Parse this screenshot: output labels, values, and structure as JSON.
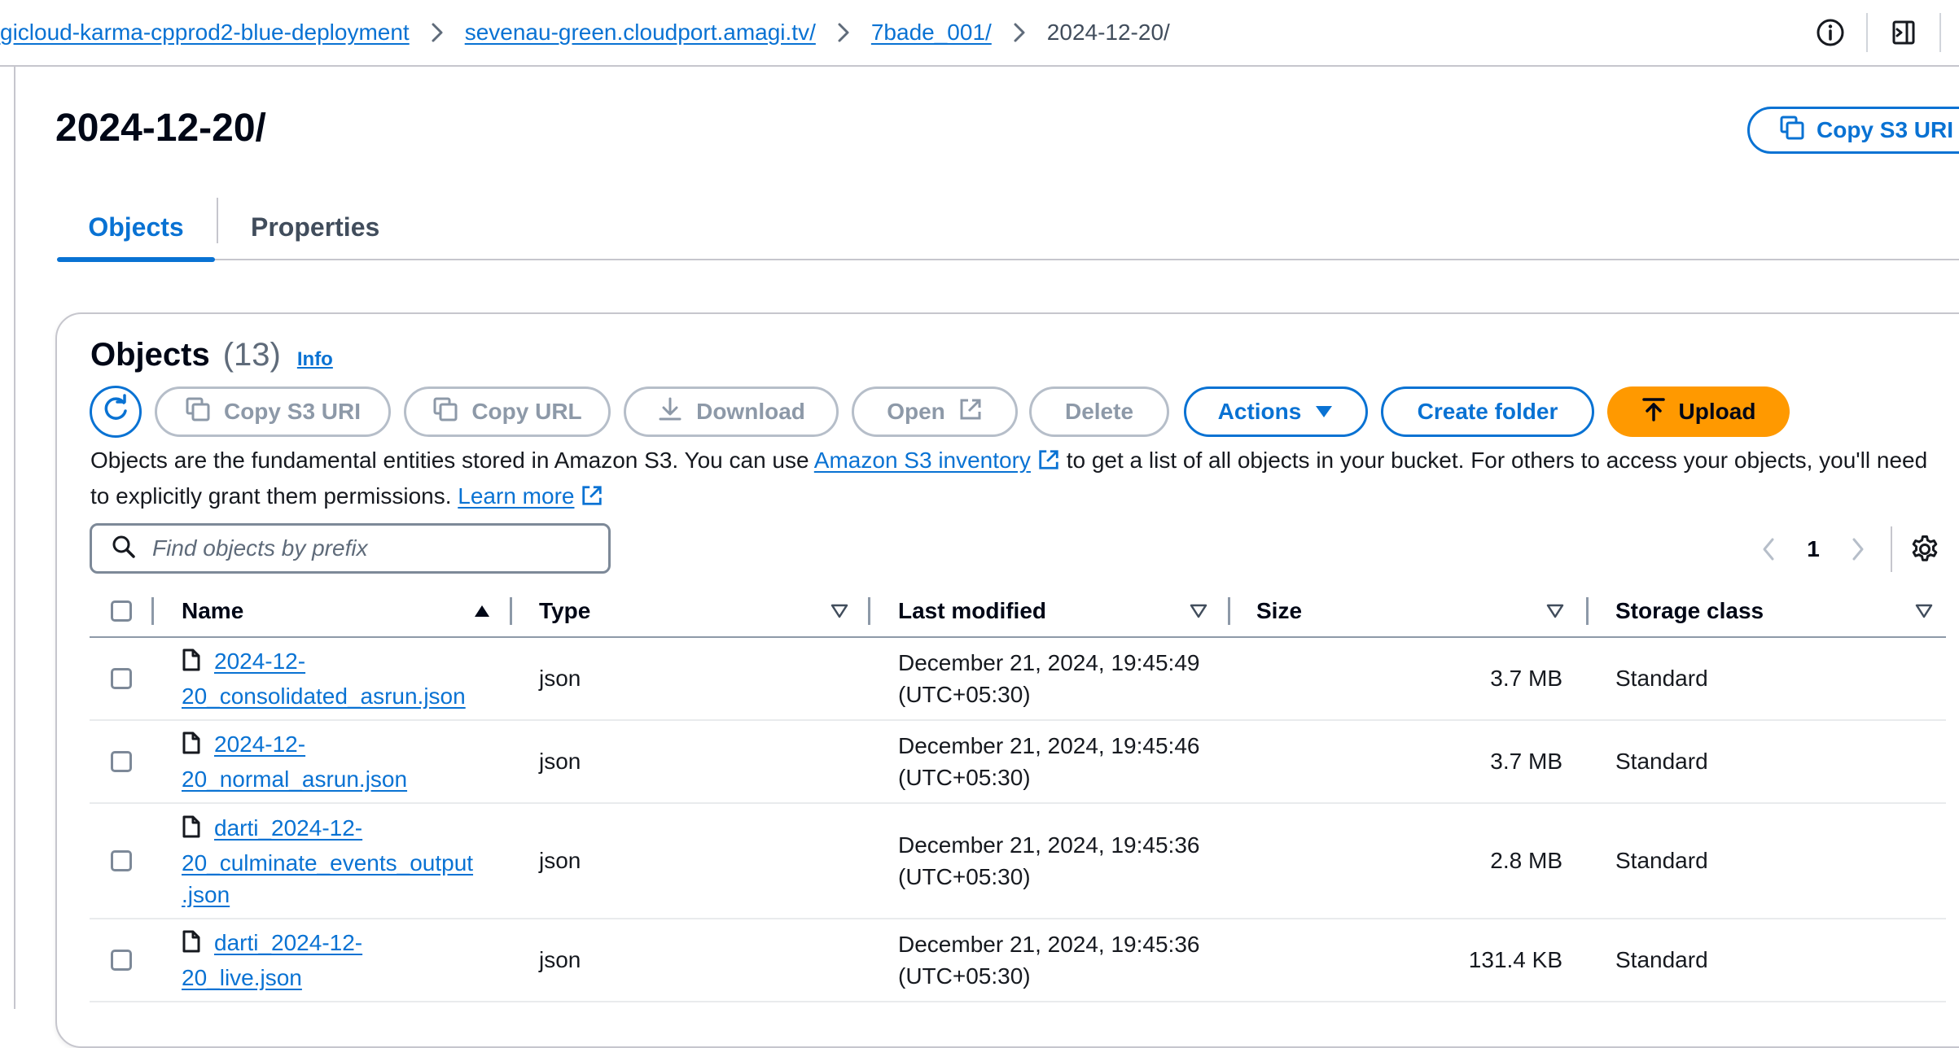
{
  "breadcrumb": {
    "items": [
      "gicloud-karma-cpprod2-blue-deployment",
      "sevenau-green.cloudport.amagi.tv/",
      "7bade_001/"
    ],
    "current": "2024-12-20/"
  },
  "page": {
    "title": "2024-12-20/",
    "copy_s3_uri": "Copy S3 URI"
  },
  "tabs": {
    "objects": "Objects",
    "properties": "Properties"
  },
  "objects_panel": {
    "title": "Objects",
    "count": "(13)",
    "info": "Info",
    "buttons": {
      "copy_s3_uri": "Copy S3 URI",
      "copy_url": "Copy URL",
      "download": "Download",
      "open": "Open",
      "delete": "Delete",
      "actions": "Actions",
      "create_folder": "Create folder",
      "upload": "Upload"
    },
    "description": {
      "part1": "Objects are the fundamental entities stored in Amazon S3. You can use ",
      "inventory_link": "Amazon S3 inventory",
      "part2": " to get a list of all objects in your bucket. For others to access your objects, you'll need to explicitly grant them permissions. ",
      "learn_more": "Learn more"
    },
    "search_placeholder": "Find objects by prefix",
    "pagination": {
      "current_page": "1"
    },
    "columns": {
      "name": "Name",
      "type": "Type",
      "last_modified": "Last modified",
      "size": "Size",
      "storage_class": "Storage class"
    },
    "rows": [
      {
        "name_line1": "2024-12-",
        "name_line2": "20_consolidated_asrun.json",
        "name_line3": "",
        "type": "json",
        "modified_date": "December 21, 2024, 19:45:49",
        "modified_tz": "(UTC+05:30)",
        "size": "3.7 MB",
        "storage_class": "Standard"
      },
      {
        "name_line1": "2024-12-",
        "name_line2": "20_normal_asrun.json",
        "name_line3": "",
        "type": "json",
        "modified_date": "December 21, 2024, 19:45:46",
        "modified_tz": "(UTC+05:30)",
        "size": "3.7 MB",
        "storage_class": "Standard"
      },
      {
        "name_line1": "darti_2024-12-",
        "name_line2": "20_culminate_events_output",
        "name_line3": ".json",
        "type": "json",
        "modified_date": "December 21, 2024, 19:45:36",
        "modified_tz": "(UTC+05:30)",
        "size": "2.8 MB",
        "storage_class": "Standard"
      },
      {
        "name_line1": "darti_2024-12-",
        "name_line2": "20_live.json",
        "name_line3": "",
        "type": "json",
        "modified_date": "December 21, 2024, 19:45:36",
        "modified_tz": "(UTC+05:30)",
        "size": "131.4 KB",
        "storage_class": "Standard"
      }
    ]
  },
  "icons": {
    "breadcrumb_separator": "chevron-right-icon",
    "info": "info-circle-icon",
    "tools": "tools-panel-icon",
    "copy": "copy-icon",
    "refresh": "refresh-icon",
    "download": "download-icon",
    "external": "external-link-icon",
    "dropdown": "caret-down-icon",
    "upload": "upload-icon",
    "search": "search-icon",
    "settings": "gear-icon",
    "file": "file-icon"
  },
  "colors": {
    "link": "#0972d3",
    "upload_button": "#ff9900",
    "disabled_text": "#8d99a8"
  }
}
